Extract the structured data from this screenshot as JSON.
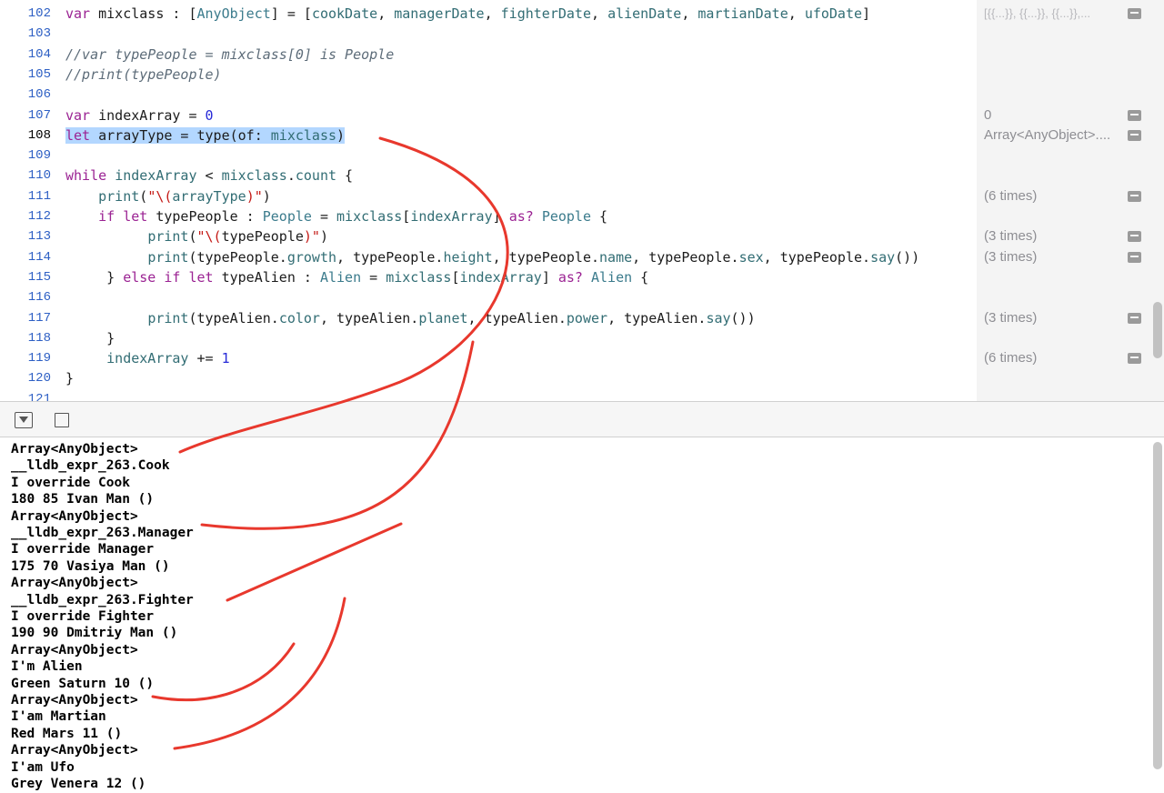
{
  "editor": {
    "lines": [
      {
        "num": "102",
        "tokens": [
          [
            "kw",
            "var"
          ],
          [
            "p",
            " mixclass : ["
          ],
          [
            "type",
            "AnyObject"
          ],
          [
            "p",
            "] = ["
          ],
          [
            "prop",
            "cookDate"
          ],
          [
            "p",
            ", "
          ],
          [
            "prop",
            "managerDate"
          ],
          [
            "p",
            ", "
          ],
          [
            "prop",
            "fighterDate"
          ],
          [
            "p",
            ", "
          ],
          [
            "prop",
            "alienDate"
          ],
          [
            "p",
            ", "
          ],
          [
            "prop",
            "martianDate"
          ],
          [
            "p",
            ", "
          ],
          [
            "prop",
            "ufoDate"
          ],
          [
            "p",
            "]"
          ]
        ]
      },
      {
        "num": "103",
        "tokens": []
      },
      {
        "num": "104",
        "tokens": [
          [
            "cmt",
            "//var typePeople = mixclass[0] is People"
          ]
        ]
      },
      {
        "num": "105",
        "tokens": [
          [
            "cmt",
            "//print(typePeople)"
          ]
        ]
      },
      {
        "num": "106",
        "tokens": []
      },
      {
        "num": "107",
        "tokens": [
          [
            "kw",
            "var"
          ],
          [
            "p",
            " indexArray = "
          ],
          [
            "num",
            "0"
          ]
        ]
      },
      {
        "num": "108",
        "current": true,
        "selected": true,
        "tokens": [
          [
            "kw",
            "let"
          ],
          [
            "p",
            " arrayType = type(of: "
          ],
          [
            "prop",
            "mixclass"
          ],
          [
            "p",
            ")"
          ]
        ]
      },
      {
        "num": "109",
        "tokens": []
      },
      {
        "num": "110",
        "tokens": [
          [
            "kw",
            "while"
          ],
          [
            "p",
            " "
          ],
          [
            "prop",
            "indexArray"
          ],
          [
            "p",
            " < "
          ],
          [
            "prop",
            "mixclass"
          ],
          [
            "p",
            "."
          ],
          [
            "prop",
            "count"
          ],
          [
            "p",
            " {"
          ]
        ]
      },
      {
        "num": "111",
        "tokens": [
          [
            "p",
            "    "
          ],
          [
            "prop",
            "print"
          ],
          [
            "p",
            "("
          ],
          [
            "str",
            "\"\\("
          ],
          [
            "prop",
            "arrayType"
          ],
          [
            "str",
            ")\""
          ],
          [
            "p",
            ")"
          ]
        ]
      },
      {
        "num": "112",
        "tokens": [
          [
            "p",
            "    "
          ],
          [
            "kw",
            "if let"
          ],
          [
            "p",
            " typePeople : "
          ],
          [
            "type",
            "People"
          ],
          [
            "p",
            " = "
          ],
          [
            "prop",
            "mixclass"
          ],
          [
            "p",
            "["
          ],
          [
            "prop",
            "indexArray"
          ],
          [
            "p",
            "] "
          ],
          [
            "kw",
            "as?"
          ],
          [
            "p",
            " "
          ],
          [
            "type",
            "People"
          ],
          [
            "p",
            " {"
          ]
        ]
      },
      {
        "num": "113",
        "tokens": [
          [
            "p",
            "          "
          ],
          [
            "prop",
            "print"
          ],
          [
            "p",
            "("
          ],
          [
            "str",
            "\"\\("
          ],
          [
            "p",
            "typePeople"
          ],
          [
            "str",
            ")\""
          ],
          [
            "p",
            ")"
          ]
        ]
      },
      {
        "num": "114",
        "tokens": [
          [
            "p",
            "          "
          ],
          [
            "prop",
            "print"
          ],
          [
            "p",
            "(typePeople."
          ],
          [
            "prop",
            "growth"
          ],
          [
            "p",
            ", typePeople."
          ],
          [
            "prop",
            "height"
          ],
          [
            "p",
            ", typePeople."
          ],
          [
            "prop",
            "name"
          ],
          [
            "p",
            ", typePeople."
          ],
          [
            "prop",
            "sex"
          ],
          [
            "p",
            ", typePeople."
          ],
          [
            "prop",
            "say"
          ],
          [
            "p",
            "())"
          ]
        ]
      },
      {
        "num": "115",
        "tokens": [
          [
            "p",
            "     } "
          ],
          [
            "kw",
            "else if let"
          ],
          [
            "p",
            " typeAlien : "
          ],
          [
            "type",
            "Alien"
          ],
          [
            "p",
            " = "
          ],
          [
            "prop",
            "mixclass"
          ],
          [
            "p",
            "["
          ],
          [
            "prop",
            "indexArray"
          ],
          [
            "p",
            "] "
          ],
          [
            "kw",
            "as?"
          ],
          [
            "p",
            " "
          ],
          [
            "type",
            "Alien"
          ],
          [
            "p",
            " {"
          ]
        ]
      },
      {
        "num": "116",
        "tokens": []
      },
      {
        "num": "117",
        "tokens": [
          [
            "p",
            "          "
          ],
          [
            "prop",
            "print"
          ],
          [
            "p",
            "(typeAlien."
          ],
          [
            "prop",
            "color"
          ],
          [
            "p",
            ", typeAlien."
          ],
          [
            "prop",
            "planet"
          ],
          [
            "p",
            ", typeAlien."
          ],
          [
            "prop",
            "power"
          ],
          [
            "p",
            ", typeAlien."
          ],
          [
            "prop",
            "say"
          ],
          [
            "p",
            "())"
          ]
        ]
      },
      {
        "num": "118",
        "tokens": [
          [
            "p",
            "     }"
          ]
        ]
      },
      {
        "num": "119",
        "tokens": [
          [
            "p",
            "     "
          ],
          [
            "prop",
            "indexArray"
          ],
          [
            "p",
            " += "
          ],
          [
            "num",
            "1"
          ]
        ]
      },
      {
        "num": "120",
        "tokens": [
          [
            "p",
            "}"
          ]
        ]
      },
      {
        "num": "121",
        "tokens": []
      }
    ],
    "results": [
      {
        "line": 0,
        "text": "[{{...}}, {{...}}, {{...}},...",
        "faint": true
      },
      {
        "line": 5,
        "text": "0"
      },
      {
        "line": 6,
        "text": "Array<AnyObject>...."
      },
      {
        "line": 9,
        "text": "(6 times)"
      },
      {
        "line": 11,
        "text": "(3 times)"
      },
      {
        "line": 12,
        "text": "(3 times)"
      },
      {
        "line": 15,
        "text": "(3 times)"
      },
      {
        "line": 17,
        "text": "(6 times)"
      }
    ]
  },
  "debug_bar": {
    "hide_icon": "hide-debug-area-icon",
    "console_icon": "console-toggle-icon"
  },
  "console": {
    "lines": [
      "Array<AnyObject>",
      "__lldb_expr_263.Cook",
      "I override Cook",
      "180 85 Ivan Man ()",
      "Array<AnyObject>",
      "__lldb_expr_263.Manager",
      "I override Manager",
      "175 70 Vasiya Man ()",
      "Array<AnyObject>",
      "__lldb_expr_263.Fighter",
      "I override Fighter",
      "190 90 Dmitriy Man ()",
      "Array<AnyObject>",
      "I'm Alien",
      "Green Saturn 10 ()",
      "Array<AnyObject>",
      "I'am Martian",
      "Red Mars 11 ()",
      "Array<AnyObject>",
      "I'am Ufo",
      "Grey Venera 12 ()"
    ]
  },
  "colors": {
    "annotation": "#e8382d",
    "line_number": "#2d5fc4",
    "selection": "#b3d7ff",
    "keyword": "#9b2393"
  }
}
